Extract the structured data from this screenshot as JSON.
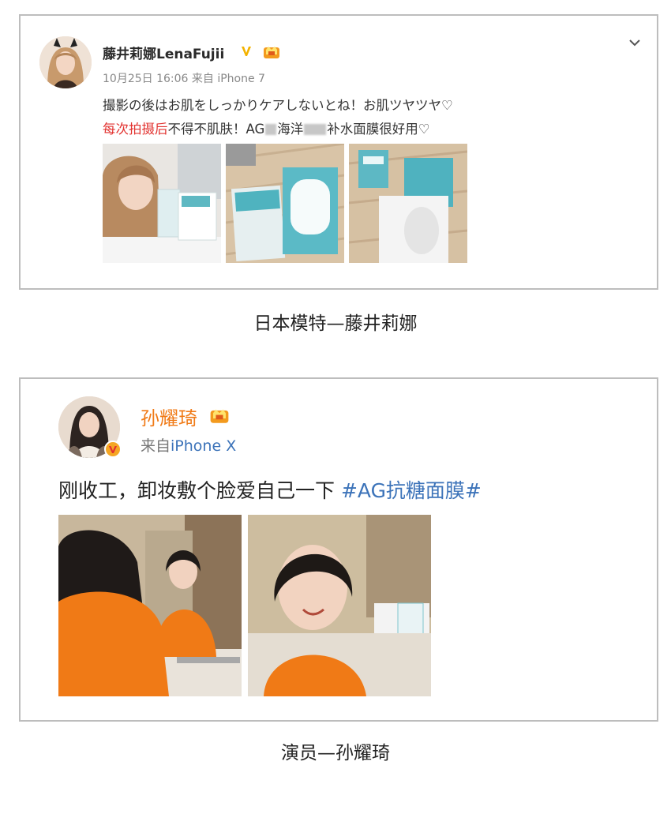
{
  "post1": {
    "username": "藤井莉娜LenaFujii",
    "time_and_source": "10月25日 16:06 来自 iPhone 7",
    "line1": "撮影の後はお肌をしっかりケアしないとね！お肌ツヤツヤ♡",
    "line2_red": "每次拍摄后",
    "line2_a": "不得不肌肤！AG",
    "line2_b": "海洋",
    "line2_c": "补水面膜很好用♡",
    "images": [
      "model-selfie-with-mask",
      "mask-package-on-table",
      "mask-packages-open"
    ],
    "caption": "日本模特—藤井莉娜"
  },
  "post2": {
    "username": "孙耀琦",
    "source_prefix": "来自",
    "source_device": "iPhone X",
    "text": "刚收工，卸妆敷个脸爱自己一下 ",
    "hashtag": "#AG抗糖面膜#",
    "images": [
      "mirror-selfie-orange-hoodie",
      "smiling-selfie-with-mask-box"
    ],
    "caption": "演员—孙耀琦"
  },
  "colors": {
    "orange_name": "#f07a16",
    "link_blue": "#3c73b9",
    "red_text": "#e2322f",
    "verified_gold": "#f3b200",
    "border": "#bdbdbd"
  },
  "icons": [
    "chevron-down-icon",
    "verified-v-icon",
    "vip-crown-icon",
    "verified-badge-icon"
  ]
}
